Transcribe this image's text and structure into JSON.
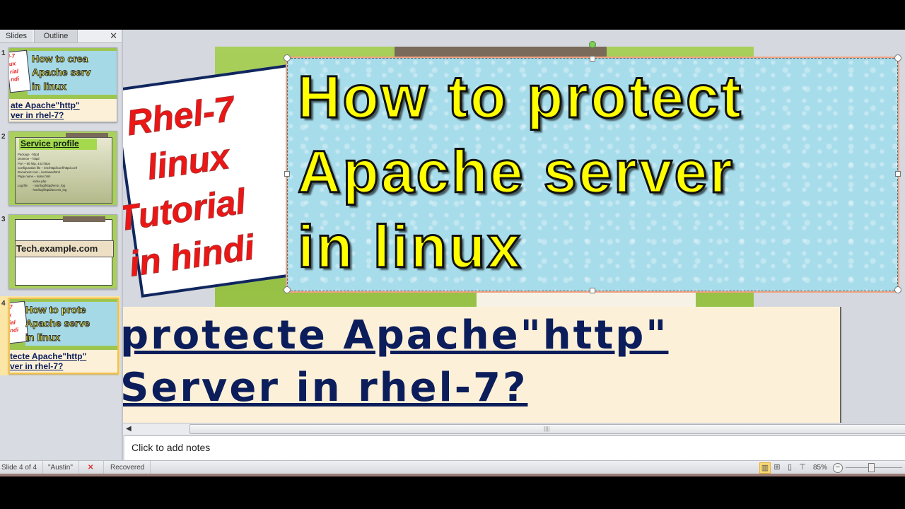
{
  "panel": {
    "tabs": [
      {
        "label": "Slides"
      },
      {
        "label": "Outline"
      }
    ],
    "close_glyph": "✕",
    "slides": [
      {
        "number": "1",
        "card_text": [
          "l-7",
          "ux",
          "rial",
          "ndi"
        ],
        "title_lines": [
          "How to crea",
          "Apache serv",
          "in linux"
        ],
        "subtitle_lines": [
          "ate Apache\"http\"",
          "ver in rhel-7?"
        ]
      },
      {
        "number": "2",
        "heading": "Service profile",
        "lines": [
          "Package  -httpd",
          "Deamon – httpd",
          "Port – 80 http, 443 https",
          "Configuration file – /etc/httpd/conf/httpd.conf",
          "Document root – /var/www/html",
          "Page name – index.html",
          "                 -index.php",
          "Log file      - /var/log/httpd/error_log",
          "                 -/var/log/httpd/access_log"
        ]
      },
      {
        "number": "3",
        "banner": "Tech.example.com"
      },
      {
        "number": "4",
        "card_text": [
          "-7",
          "x",
          "ial",
          "ndi"
        ],
        "title_lines": [
          "How to prote",
          "Apache serve",
          "in linux"
        ],
        "subtitle_lines": [
          "tecte Apache\"http\"",
          "ver in rhel-7?"
        ],
        "selected": true
      }
    ]
  },
  "slide": {
    "card_lines": [
      "Rhel-7",
      "linux",
      "Tutorial",
      "in hindi"
    ],
    "title_lines": [
      "How to protect",
      "Apache server",
      "in linux"
    ],
    "subtitle_lines": [
      "protecte Apache\"http\"",
      "Server in rhel-7?"
    ]
  },
  "notes": {
    "placeholder": "Click to add notes"
  },
  "scrollbar": {
    "left_arrow": "◀",
    "grip": "||||"
  },
  "status": {
    "slide_info": "Slide 4 of 4",
    "theme": "\"Austin\"",
    "recovered": "Recovered",
    "zoom": "85%",
    "zoom_minus": "−",
    "views": [
      {
        "name": "normal",
        "glyph": "▥"
      },
      {
        "name": "slide-sorter",
        "glyph": "⊞"
      },
      {
        "name": "reading",
        "glyph": "▯"
      },
      {
        "name": "slideshow",
        "glyph": "⊤"
      }
    ]
  }
}
